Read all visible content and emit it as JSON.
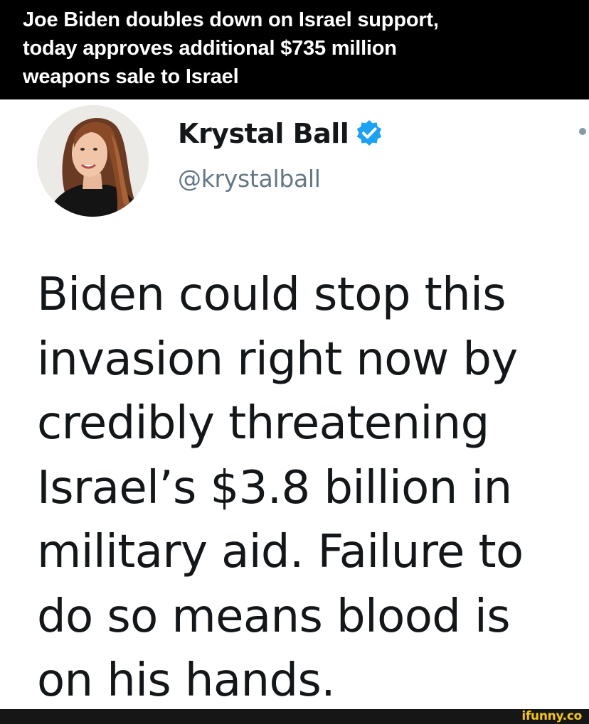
{
  "caption": {
    "lines": [
      "Joe Biden doubles down on Israel support,",
      "today approves additional $735 million",
      "weapons sale to Israel"
    ]
  },
  "tweet": {
    "author": {
      "name": "Krystal Ball",
      "handle": "@krystalball",
      "verified": true,
      "avatar_icon": "profile-photo"
    },
    "body_lines": [
      "Biden could stop this",
      "invasion right now by",
      "credibly threatening",
      "Israel’s $3.8 billion in",
      "military aid. Failure to",
      "do so means blood is",
      "on his hands."
    ]
  },
  "watermark": {
    "text": "ifunny.co"
  },
  "colors": {
    "caption_bg": "#000000",
    "caption_text": "#ffffff",
    "tweet_text": "#14171a",
    "handle_text": "#657786",
    "verified_blue": "#1da1f2",
    "watermark": "#f5c518",
    "footer_bg": "#161616"
  }
}
